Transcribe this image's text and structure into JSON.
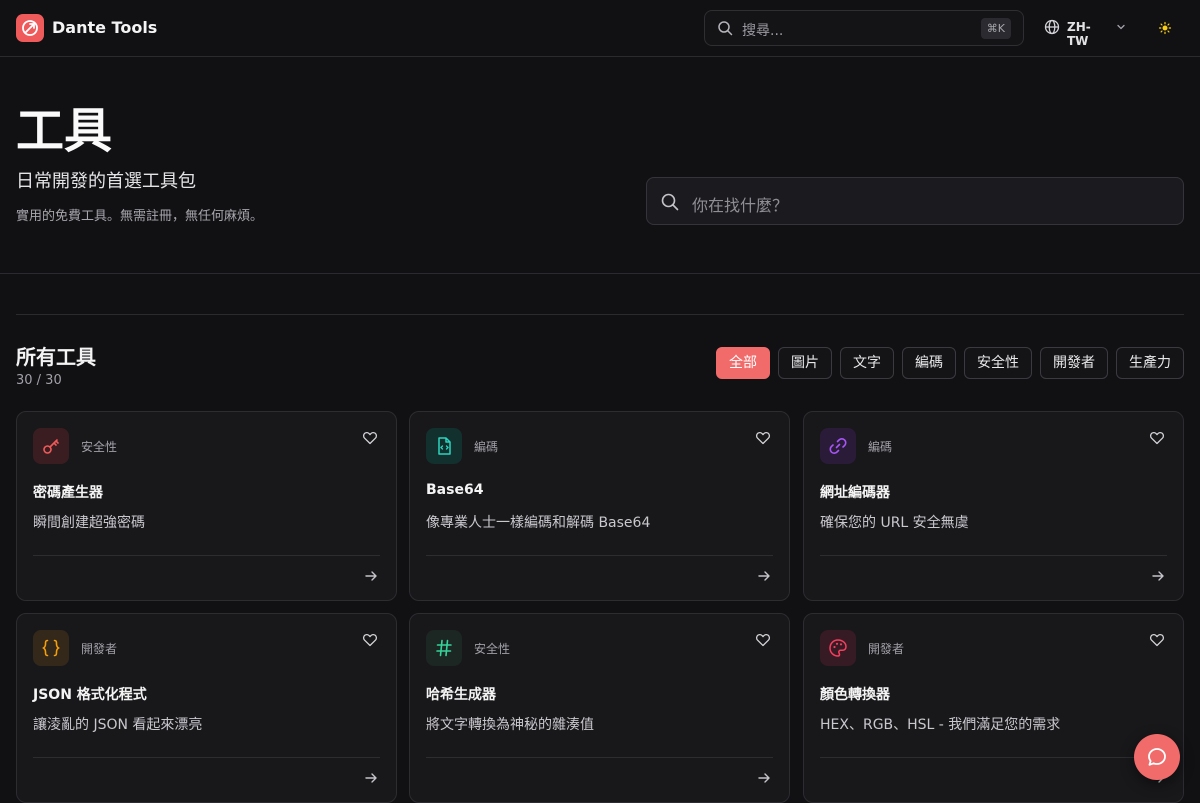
{
  "header": {
    "brand": "Dante Tools",
    "search_placeholder": "搜尋...",
    "shortcut": "⌘K",
    "language": "ZH-TW"
  },
  "hero": {
    "title": "工具",
    "subtitle": "日常開發的首選工具包",
    "description": "實用的免費工具。無需註冊，無任何麻煩。",
    "search_placeholder": "你在找什麼？"
  },
  "section": {
    "title": "所有工具",
    "count": "30 / 30"
  },
  "filters": [
    "全部",
    "圖片",
    "文字",
    "編碼",
    "安全性",
    "開發者",
    "生產力"
  ],
  "active_filter": "全部",
  "tools": [
    {
      "category": "安全性",
      "name": "密碼產生器",
      "description": "瞬間創建超強密碼",
      "icon": "key-icon",
      "color": "#ef5b5b"
    },
    {
      "category": "編碼",
      "name": "Base64",
      "description": "像專業人士一樣編碼和解碼 Base64",
      "icon": "file-code-icon",
      "color": "#2dd4bf"
    },
    {
      "category": "編碼",
      "name": "網址編碼器",
      "description": "確保您的 URL 安全無虞",
      "icon": "link-icon",
      "color": "#a855f7"
    },
    {
      "category": "開發者",
      "name": "JSON 格式化程式",
      "description": "讓淩亂的 JSON 看起來漂亮",
      "icon": "braces-icon",
      "color": "#f59e0b"
    },
    {
      "category": "安全性",
      "name": "哈希生成器",
      "description": "將文字轉換為神秘的雜湊值",
      "icon": "hash-icon",
      "color": "#34d399"
    },
    {
      "category": "開發者",
      "name": "顏色轉換器",
      "description": "HEX、RGB、HSL - 我們滿足您的需求",
      "icon": "palette-icon",
      "color": "#f43f5e"
    }
  ],
  "colors": {
    "accent": "#f26b6b",
    "background": "#111114",
    "card": "#18181b"
  }
}
